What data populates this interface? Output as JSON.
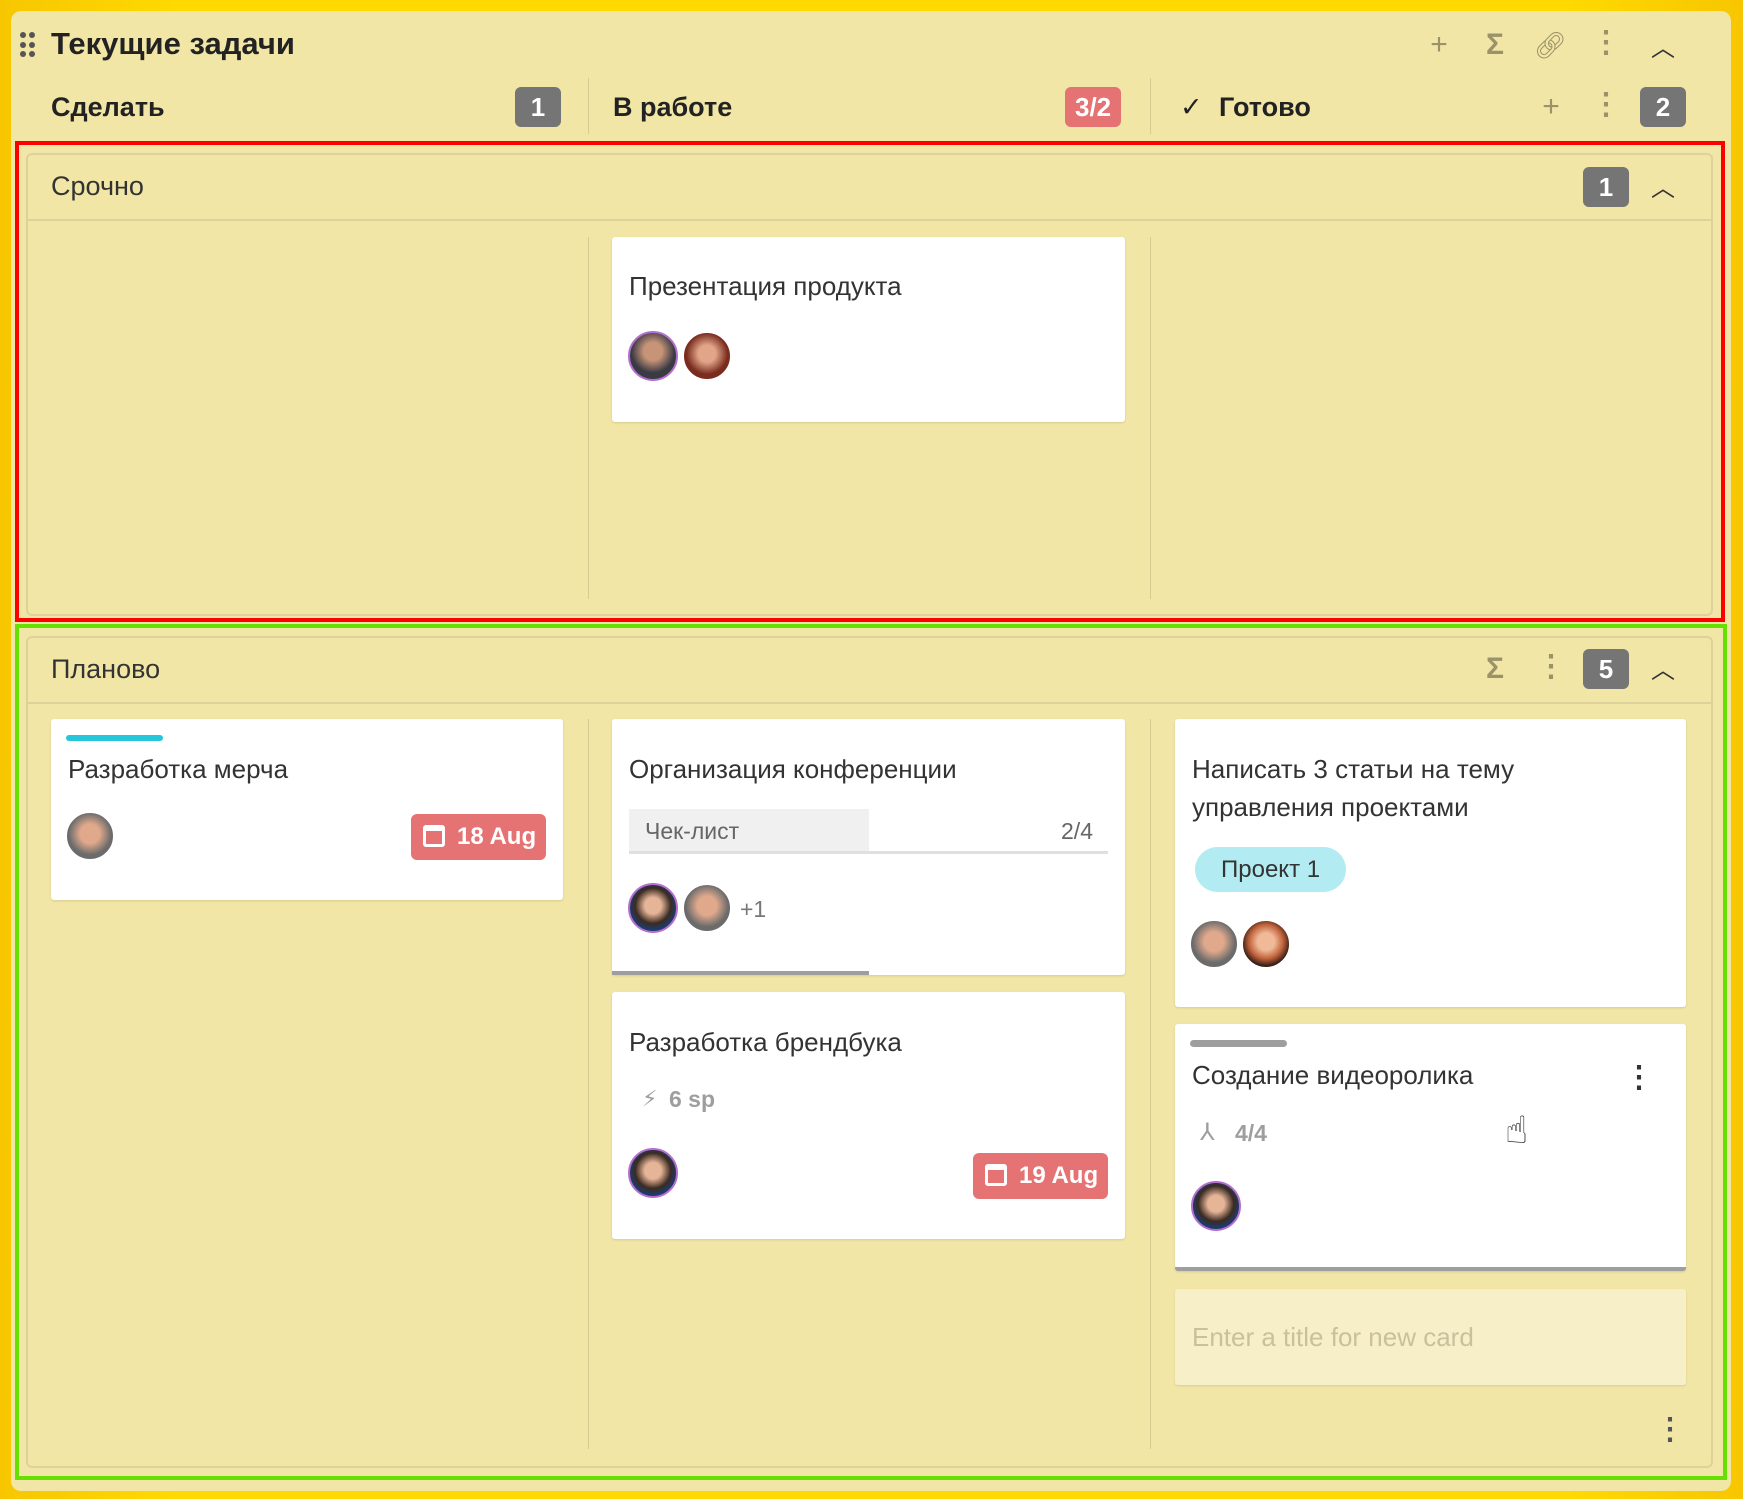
{
  "board": {
    "title": "Текущие задачи",
    "icons": [
      "drag-handle-icon",
      "plus-icon",
      "sigma-icon",
      "link-icon",
      "more-vert-icon",
      "chevron-up-icon"
    ]
  },
  "columns": [
    {
      "label": "Сделать",
      "count": "1"
    },
    {
      "label": "В работе",
      "count": "3/2",
      "count_color": "#e57373"
    },
    {
      "label": "Готово",
      "count": "2",
      "check": "✓"
    }
  ],
  "swimlanes": [
    {
      "title": "Срочно",
      "count": "1"
    },
    {
      "title": "Планово",
      "count": "5"
    }
  ],
  "cards": {
    "presentation": {
      "title": "Презентация продукта"
    },
    "merch": {
      "title": "Разработка мерча",
      "date": "18 Aug",
      "accent": "#26c6da"
    },
    "conference": {
      "title": "Организация конференции",
      "checklist_label": "Чек-лист",
      "checklist_value": "2/4",
      "checklist_progress": 0.5,
      "extra_members": "+1"
    },
    "brandbook": {
      "title": "Разработка брендбука",
      "points": "6 sp",
      "date": "19 Aug"
    },
    "articles": {
      "title_line1": "Написать 3 статьи на тему",
      "title_line2": "управления проектами",
      "tag": "Проект 1",
      "tag_color": "#b2ebf2"
    },
    "video": {
      "title": "Создание видеоролика",
      "subtasks": "4/4"
    }
  },
  "new_card": {
    "placeholder": "Enter a title for new card"
  },
  "colors": {
    "background": "#ffd700",
    "panel": "#f1e6a6",
    "badge": "#757575",
    "date": "#e57373",
    "highlight_urgent": "#ff0000",
    "highlight_planned": "#66e000"
  }
}
